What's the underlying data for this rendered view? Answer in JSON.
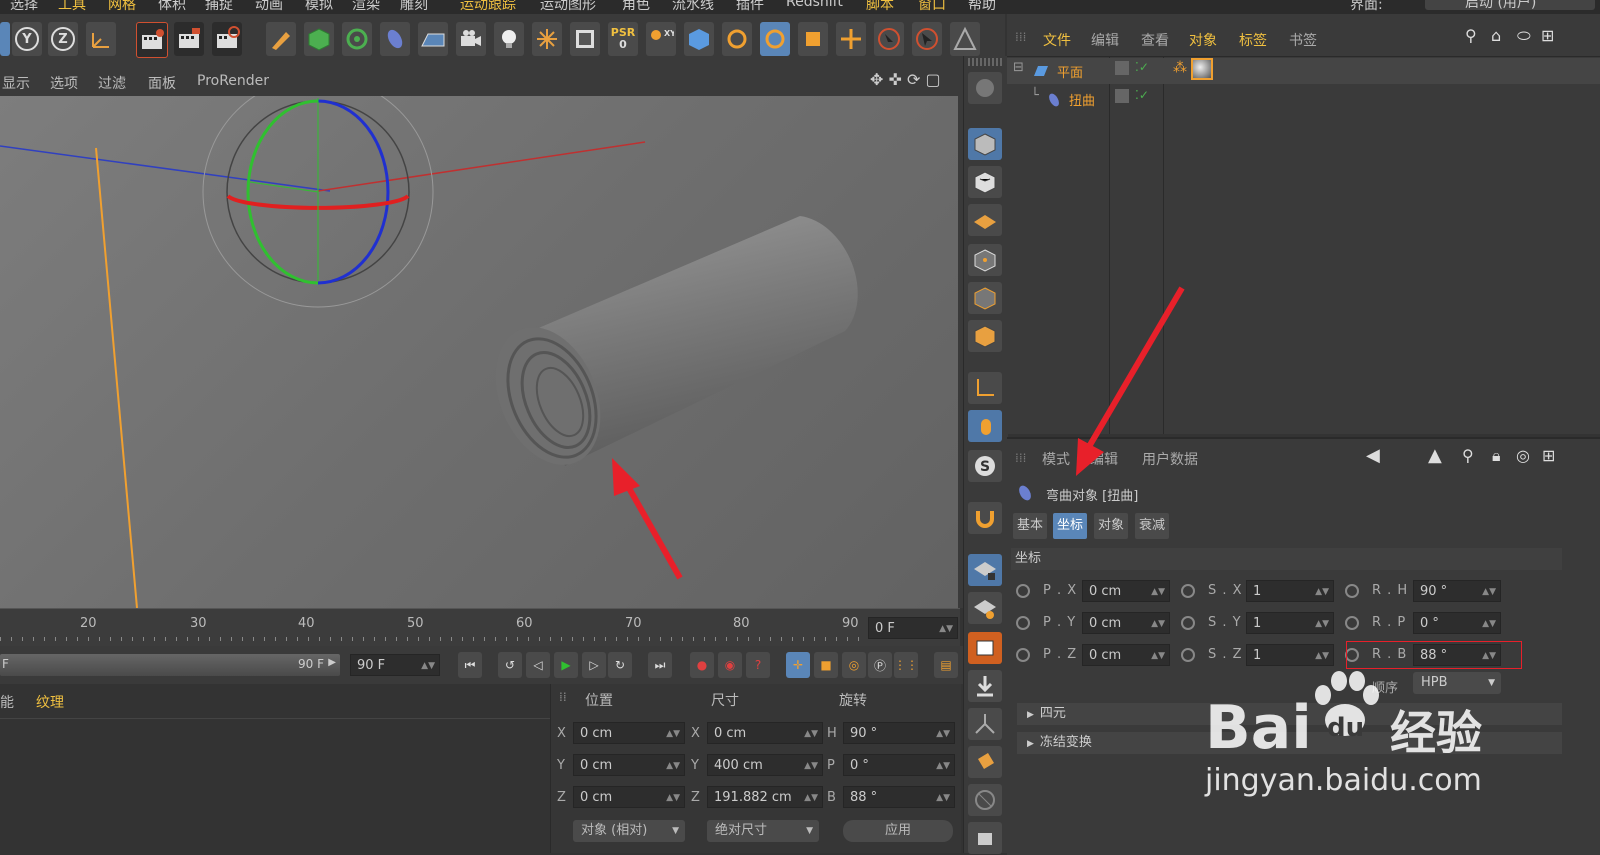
{
  "menubar": {
    "items": [
      "选择",
      "工具",
      "网格",
      "体积",
      "捕捉",
      "动画",
      "模拟",
      "渲染",
      "雕刻",
      "运动跟踪",
      "运动图形",
      "角色",
      "流水线",
      "插件",
      "Redshift",
      "脚本",
      "窗口",
      "帮助"
    ],
    "layout_label": "界面:",
    "layout_value": "启动 (用户)"
  },
  "toolbar": {
    "axis_y": "Y",
    "axis_z": "Z",
    "psr_label": "PSR",
    "psr_value": "0"
  },
  "viewport_menu": {
    "items": [
      "显示",
      "选项",
      "过滤",
      "面板",
      "ProRender"
    ]
  },
  "timeline": {
    "ticks": [
      "20",
      "30",
      "40",
      "50",
      "60",
      "70",
      "80",
      "90"
    ],
    "current_frame": "0 F",
    "end_frame_slider": "90 F",
    "end_frame_field": "90 F",
    "start_marker": "F"
  },
  "material_panel": {
    "tabs": [
      "能",
      "纹理"
    ]
  },
  "coord_panel": {
    "headers": [
      "位置",
      "尺寸",
      "旋转"
    ],
    "rows": [
      {
        "axis": "X",
        "pos": "0 cm",
        "size_axis": "X",
        "size": "0 cm",
        "rot_axis": "H",
        "rot": "90 °"
      },
      {
        "axis": "Y",
        "pos": "0 cm",
        "size_axis": "Y",
        "size": "400 cm",
        "rot_axis": "P",
        "rot": "0 °"
      },
      {
        "axis": "Z",
        "pos": "0 cm",
        "size_axis": "Z",
        "size": "191.882 cm",
        "rot_axis": "B",
        "rot": "88 °"
      }
    ],
    "mode_dropdown": "对象 (相对)",
    "size_dropdown": "绝对尺寸",
    "apply_button": "应用"
  },
  "object_manager": {
    "menu": [
      "文件",
      "编辑",
      "查看",
      "对象",
      "标签",
      "书签"
    ],
    "objects": [
      {
        "name": "平面"
      },
      {
        "name": "扭曲"
      }
    ]
  },
  "attribute_manager": {
    "menu": [
      "模式",
      "编辑",
      "用户数据"
    ],
    "title": "弯曲对象 [扭曲]",
    "tabs": [
      "基本",
      "坐标",
      "对象",
      "衰减"
    ],
    "section": "坐标",
    "fields": {
      "px_label": "P . X",
      "px": "0 cm",
      "py_label": "P . Y",
      "py": "0 cm",
      "pz_label": "P . Z",
      "pz": "0 cm",
      "sx_label": "S . X",
      "sx": "1",
      "sy_label": "S . Y",
      "sy": "1",
      "sz_label": "S . Z",
      "sz": "1",
      "rh_label": "R . H",
      "rh": "90 °",
      "rp_label": "R . P",
      "rp": "0 °",
      "rb_label": "R . B",
      "rb": "88 °"
    },
    "order_label": "顺序",
    "order_value": "HPB",
    "quaternion": "四元",
    "freeze": "冻结变换"
  },
  "watermark": {
    "brand": "Bai",
    "brand2": "du",
    "jingyan": "经验",
    "url": "jingyan.baidu.com"
  },
  "colors": {
    "accent_blue": "#5a86b8",
    "highlight_yellow": "#f0c040",
    "annotation_red": "#e8202a"
  }
}
